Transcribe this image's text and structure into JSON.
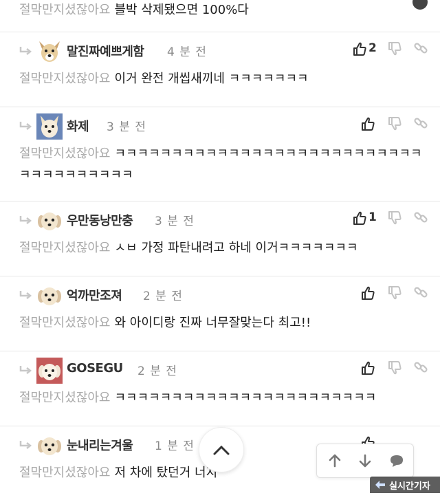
{
  "top_comment": {
    "mention": "절막만지셨잖아요",
    "text": "블박 삭제됐으면 100%다"
  },
  "replies": [
    {
      "author": "말진짜예쁘게함",
      "time": "4 분 전",
      "likes": "2",
      "mention": "절막만지셨잖아요",
      "text": "이거 완전 개씹새끼네 ㅋㅋㅋㅋㅋㅋㅋ"
    },
    {
      "author": "화제",
      "time": "3 분 전",
      "likes": "",
      "mention": "절막만지셨잖아요",
      "text": "ㅋㅋㅋㅋㅋㅋㅋㅋㅋㅋㅋㅋㅋㅋㅋㅋㅋㅋㅋㅋㅋㅋㅋㅋㅋㅋㅋㅋㅋㅋㅋㅋㅋㅋㅋㅋㅋ"
    },
    {
      "author": "우만동낭만충",
      "time": "3 분 전",
      "likes": "1",
      "mention": "절막만지셨잖아요",
      "text": "ㅅㅂ 가정 파탄내려고 하네 이거ㅋㅋㅋㅋㅋㅋㅋ"
    },
    {
      "author": "억까만조져",
      "time": "2 분 전",
      "likes": "",
      "mention": "절막만지셨잖아요",
      "text": "와 아이디랑 진짜 너무잘맞는다 최고!!"
    },
    {
      "author": "GOSEGU",
      "time": "2 분 전",
      "likes": "",
      "mention": "절막만지셨잖아요",
      "text": "ㅋㅋㅋㅋㅋㅋㅋㅋㅋㅋㅋㅋㅋㅋㅋㅋㅋㅋㅋㅋㅋㅋㅋ"
    },
    {
      "author": "눈내리는겨울",
      "time": "1 분 전",
      "likes": "",
      "mention": "절막만지셨잖아요",
      "text": "저 차에 탔던거 너지"
    }
  ],
  "watermark": {
    "text": "실시간기자"
  },
  "colors": {
    "accent": "#222222",
    "muted": "#a9a9a9",
    "divider": "#e6e6e6",
    "icon": "#666666"
  }
}
